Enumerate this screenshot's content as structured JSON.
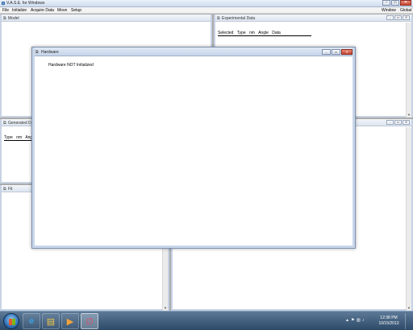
{
  "app": {
    "title": "V.A.S.E. for Windows"
  },
  "menu": {
    "left": [
      "File",
      "Initialize",
      "Acquire Data",
      "Move",
      "Setup"
    ],
    "right": [
      "Window",
      "Global"
    ]
  },
  "windows": {
    "model": {
      "title": "Model"
    },
    "experimental": {
      "title": "Experimental Data",
      "columns": [
        "Selected",
        "Type",
        "nm",
        "Angle",
        "Data"
      ]
    },
    "generated": {
      "title": "Generated Da",
      "columns": [
        "Type",
        "nm",
        "Ang"
      ]
    },
    "fit": {
      "title": "Fit"
    },
    "hardware": {
      "title": "Hardware",
      "message": "Hardware NOT Initialized"
    }
  },
  "mdi_controls": {
    "minimize": "–",
    "restore": "▭",
    "close": "✕"
  },
  "taskbar": {
    "clock_time": "12:38 PM",
    "clock_date": "10/15/2013",
    "pinned_icons": [
      "internet-explorer-icon",
      "file-explorer-icon",
      "media-player-icon",
      "vase-app-icon"
    ]
  }
}
